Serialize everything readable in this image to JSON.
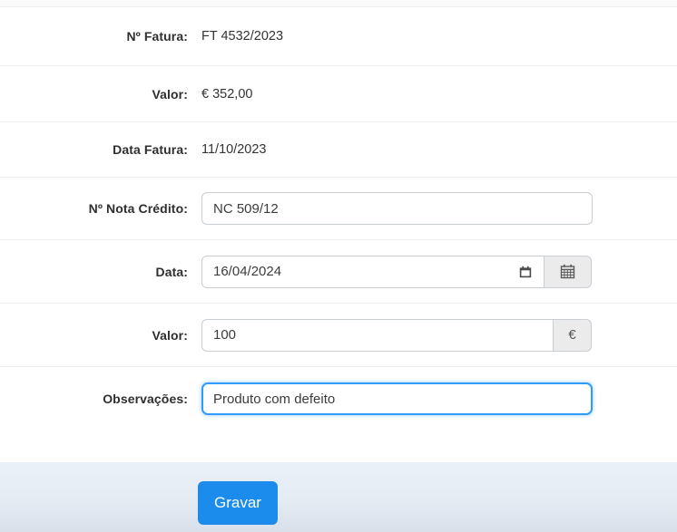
{
  "form": {
    "rows": [
      {
        "type": "static",
        "label": "Nº Fatura:",
        "value": "FT 4532/2023"
      },
      {
        "type": "static",
        "label": "Valor:",
        "value": "€ 352,00"
      },
      {
        "type": "static",
        "label": "Data Fatura:",
        "value": "11/10/2023"
      },
      {
        "type": "text",
        "label": "Nº Nota Crédito:",
        "value": "NC 509/12"
      },
      {
        "type": "date",
        "label": "Data:",
        "value": "16/04/2024",
        "addon_icon": "calendar-icon"
      },
      {
        "type": "text",
        "label": "Valor:",
        "value": "100",
        "addon": "€"
      },
      {
        "type": "text",
        "label": "Observações:",
        "value": "Produto com defeito",
        "focused": true
      }
    ]
  },
  "footer": {
    "save_label": "Gravar"
  },
  "colors": {
    "accent_button": "#1b8ceb",
    "focus_border": "#2e9bff",
    "row_divider": "#ededed",
    "addon_bg": "#ebebeb",
    "footer_bg_top": "#ebf1f8",
    "footer_bg_bottom": "#d9e0ea"
  }
}
